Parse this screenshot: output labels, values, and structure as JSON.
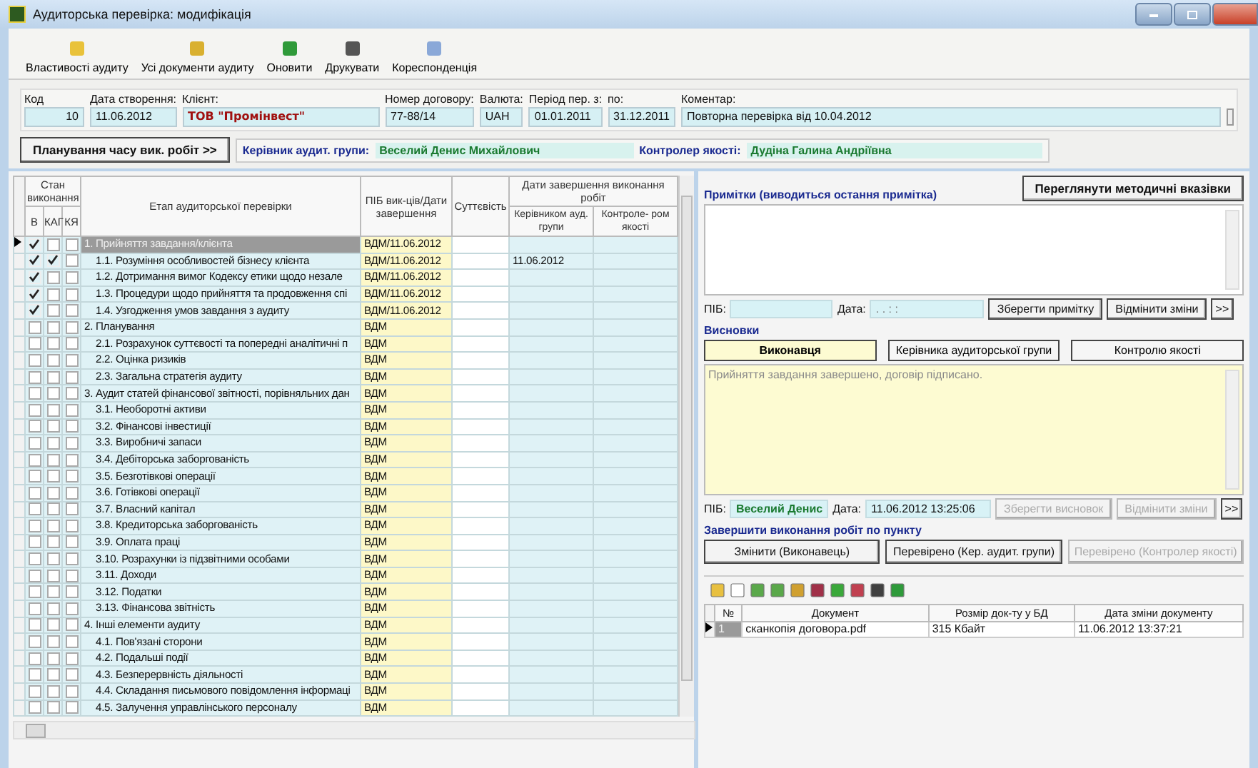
{
  "window": {
    "title": "Аудиторська перевірка: модифікація"
  },
  "toolbar": [
    "Властивості аудиту",
    "Усі документи аудиту",
    "Оновити",
    "Друкувати",
    "Кореспонденція"
  ],
  "header_fields": [
    {
      "label": "Код",
      "value": "10",
      "kind": "number"
    },
    {
      "label": "Дата створення:",
      "value": "11.06.2012",
      "kind": "plain"
    },
    {
      "label": "Клієнт:",
      "value": "ТОВ \"Промінвест\"",
      "kind": "client"
    },
    {
      "label": "Номер договору:",
      "value": "77-88/14",
      "kind": "plain"
    },
    {
      "label": "Валюта:",
      "value": "UAH",
      "kind": "plain"
    },
    {
      "label": "Період пер. з:",
      "value": "01.01.2011",
      "kind": "plain"
    },
    {
      "label": "по:",
      "value": "31.12.2011",
      "kind": "plain"
    },
    {
      "label": "Коментар:",
      "value": "Повторна перевірка від 10.04.2012",
      "kind": "comment"
    }
  ],
  "planning_button": "Планування часу вик. робіт >>",
  "team_lead": {
    "label": "Керівник аудит. групи:",
    "value": "Веселий Денис Михайлович"
  },
  "quality_controller": {
    "label": "Контролер якості:",
    "value": "Дудіна Галина Андріївна"
  },
  "audit_table": {
    "status_header": "Стан виконання",
    "status_columns": [
      "В",
      "КАГ",
      "КЯ"
    ],
    "stage_header": "Етап аудиторської перевірки",
    "executor_header": "ПІБ вик-ців/Дати завершення",
    "materiality_header": "Суттєвість",
    "dates_header": "Дати завершення виконання робіт",
    "dates_columns": [
      "Керівником ауд. групи",
      "Контроле- ром якості"
    ],
    "rows": [
      {
        "stage": "1. Прийняття завдання/клієнта",
        "executor": "ВДМ/11.06.2012",
        "checks": [
          true,
          false,
          false
        ],
        "selected": true,
        "children": [
          {
            "stage": "1.1. Розуміння особливостей бізнесу клієнта",
            "executor": "ВДМ/11.06.2012",
            "lead_date": "11.06.2012",
            "checks": [
              true,
              true,
              false
            ],
            "selected": false
          },
          {
            "stage": "1.2. Дотримання вимог Кодексу етики щодо незале",
            "executor": "ВДМ/11.06.2012",
            "checks": [
              true,
              false,
              false
            ],
            "selected": false
          },
          {
            "stage": "1.3. Процедури щодо прийняття та продовження спі",
            "executor": "ВДМ/11.06.2012",
            "checks": [
              true,
              false,
              false
            ],
            "selected": false
          },
          {
            "stage": "1.4. Узгодження умов завдання з аудиту",
            "executor": "ВДМ/11.06.2012",
            "checks": [
              true,
              false,
              false
            ],
            "selected": false
          }
        ]
      },
      {
        "stage": "2. Планування",
        "executor": "ВДМ",
        "checks": [
          false,
          false,
          false
        ],
        "selected": false,
        "children": [
          {
            "stage": "2.1. Розрахунок суттєвості та попередні аналітичні п",
            "executor": "ВДМ",
            "checks": [
              false,
              false,
              false
            ],
            "selected": false
          },
          {
            "stage": "2.2. Оцінка ризиків",
            "executor": "ВДМ",
            "checks": [
              false,
              false,
              false
            ],
            "selected": false
          },
          {
            "stage": "2.3. Загальна стратегія аудиту",
            "executor": "ВДМ",
            "checks": [
              false,
              false,
              false
            ],
            "selected": false
          }
        ]
      },
      {
        "stage": "3. Аудит статей фінансової звітності, порівняльних дан",
        "executor": "ВДМ",
        "checks": [
          false,
          false,
          false
        ],
        "selected": false,
        "children": [
          {
            "stage": "3.1. Необоротні активи",
            "executor": "ВДМ",
            "checks": [
              false,
              false,
              false
            ],
            "selected": false
          },
          {
            "stage": "3.2. Фінансові інвестиції",
            "executor": "ВДМ",
            "checks": [
              false,
              false,
              false
            ],
            "selected": false
          },
          {
            "stage": "3.3. Виробничі запаси",
            "executor": "ВДМ",
            "checks": [
              false,
              false,
              false
            ],
            "selected": false
          },
          {
            "stage": "3.4. Дебіторська заборгованість",
            "executor": "ВДМ",
            "checks": [
              false,
              false,
              false
            ],
            "selected": false
          },
          {
            "stage": "3.5. Безготівкові операції",
            "executor": "ВДМ",
            "checks": [
              false,
              false,
              false
            ],
            "selected": false
          },
          {
            "stage": "3.6. Готівкові операції",
            "executor": "ВДМ",
            "checks": [
              false,
              false,
              false
            ],
            "selected": false
          },
          {
            "stage": "3.7. Власний капітал",
            "executor": "ВДМ",
            "checks": [
              false,
              false,
              false
            ],
            "selected": false
          },
          {
            "stage": "3.8. Кредиторська заборгованість",
            "executor": "ВДМ",
            "checks": [
              false,
              false,
              false
            ],
            "selected": false
          },
          {
            "stage": "3.9. Оплата праці",
            "executor": "ВДМ",
            "checks": [
              false,
              false,
              false
            ],
            "selected": false
          },
          {
            "stage": "3.10. Розрахунки із підзвітними особами",
            "executor": "ВДМ",
            "checks": [
              false,
              false,
              false
            ],
            "selected": false
          },
          {
            "stage": "3.11. Доходи",
            "executor": "ВДМ",
            "checks": [
              false,
              false,
              false
            ],
            "selected": false
          },
          {
            "stage": "3.12. Податки",
            "executor": "ВДМ",
            "checks": [
              false,
              false,
              false
            ],
            "selected": false
          },
          {
            "stage": "3.13. Фінансова звітність",
            "executor": "ВДМ",
            "checks": [
              false,
              false,
              false
            ],
            "selected": false
          }
        ]
      },
      {
        "stage": "4. Інші елементи аудиту",
        "executor": "ВДМ",
        "checks": [
          false,
          false,
          false
        ],
        "selected": false,
        "children": [
          {
            "stage": "4.1. Пов'язані сторони",
            "executor": "ВДМ",
            "checks": [
              false,
              false,
              false
            ],
            "selected": false
          },
          {
            "stage": "4.2. Подальші події",
            "executor": "ВДМ",
            "checks": [
              false,
              false,
              false
            ],
            "selected": false
          },
          {
            "stage": "4.3. Безперервність діяльності",
            "executor": "ВДМ",
            "checks": [
              false,
              false,
              false
            ],
            "selected": false
          },
          {
            "stage": "4.4. Складання письмового повідомлення інформаці",
            "executor": "ВДМ",
            "checks": [
              false,
              false,
              false
            ],
            "selected": false
          },
          {
            "stage": "4.5. Залучення управлінського персоналу",
            "executor": "ВДМ",
            "checks": [
              false,
              false,
              false
            ],
            "selected": false
          }
        ]
      }
    ]
  },
  "notes": {
    "title": "Примітки (виводиться остання примітка)",
    "guidelines_button": "Переглянути методичні вказівки",
    "name_label": "ПІБ:",
    "date_label": "Дата:",
    "date_mask": ". .   : :",
    "buttons": [
      {
        "label": "Зберегти примітку",
        "disabled": false
      },
      {
        "label": "Відмінити зміни",
        "disabled": false
      }
    ],
    "more_button": ">>"
  },
  "conclusions": {
    "title": "Висновки",
    "tabs": [
      {
        "label": "Виконавця",
        "selected": true
      },
      {
        "label": "Керівника аудиторської групи",
        "selected": false
      },
      {
        "label": "Контролю якості",
        "selected": false
      }
    ],
    "text": "Прийняття завдання завершено, договір підписано.",
    "name_label": "ПІБ:",
    "name": "Веселий Денис",
    "date_label": "Дата:",
    "date": "11.06.2012 13:25:06",
    "buttons": [
      {
        "label": "Зберегти висновок",
        "disabled": true
      },
      {
        "label": "Відмінити зміни",
        "disabled": true
      }
    ],
    "more_button": ">>"
  },
  "completion": {
    "title": "Завершити виконання робіт по пункту",
    "buttons": [
      {
        "label": "Змінити (Виконавець)",
        "disabled": false
      },
      {
        "label": "Перевірено (Кер. аудит. групи)",
        "disabled": false
      },
      {
        "label": "Перевірено (Контролер якості)",
        "disabled": true
      }
    ]
  },
  "documents": {
    "columns": [
      "№",
      "Документ",
      "Розмір док-ту у БД",
      "Дата зміни документу"
    ],
    "rows": [
      {
        "number": "1",
        "name": "сканкопія договора.pdf",
        "size": "315 Кбайт",
        "date": "11.06.2012 13:37:21",
        "selected": true
      }
    ]
  }
}
